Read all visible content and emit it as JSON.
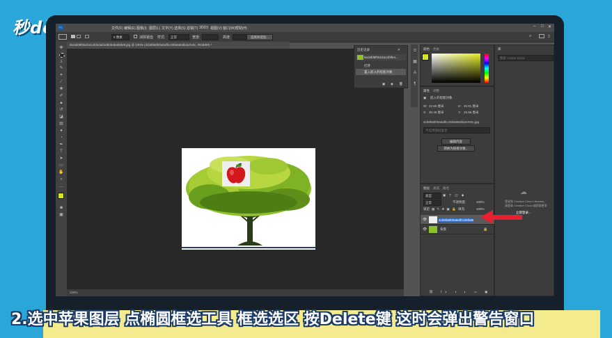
{
  "branding": {
    "logo_text": "秒dòng视频"
  },
  "menu": {
    "items": [
      "PS",
      "文件(F)",
      "编辑(E)",
      "图像(I)",
      "图层(L)",
      "文字(Y)",
      "选择(S)",
      "滤镜(T)",
      "3D(D)",
      "视图(V)",
      "窗口(W)",
      "帮助(H)"
    ]
  },
  "options": {
    "feather_value": "0 像素",
    "anti_alias_label": "消除锯齿",
    "style_label": "样式:",
    "style_value": "正常",
    "width_label": "宽度:",
    "height_label": "高度:",
    "select_mask_button": "选择并遮住..."
  },
  "document": {
    "tab_title": "8a16fd9f0522a14fde4a02d8284bab5fe8.jpg @ 100% (4cb8fa5f00a6affcc05fa550db3a7e0c, RGB/8#) *",
    "zoom_status": "100%"
  },
  "history": {
    "tabs": [
      "历史记录"
    ],
    "snapshot_label": "8a16fd9f0522a14f3fe4...",
    "items": [
      "打开",
      "置入嵌入的智能对象"
    ]
  },
  "color": {
    "tabs": [
      "颜色",
      "色板"
    ]
  },
  "properties": {
    "tabs": [
      "属性",
      "调整"
    ],
    "object_title": "嵌入的智能对象",
    "w_label": "W:",
    "w_value": "22.80 厘米",
    "h_label": "H:",
    "h_value": "20.91 厘米",
    "x_label": "X:",
    "x_value": "36.49 厘米",
    "y_label": "Y:",
    "y_value": "25.96 厘米",
    "filename": "4cb8fa5f00a6affcc05fa550db3a7e0c.jpg",
    "comp_placeholder": "不应用图层复合",
    "edit_button": "编辑内容",
    "convert_button": "转换为链接对象..."
  },
  "layers": {
    "tabs": [
      "图层",
      "通道",
      "路径"
    ],
    "kind_filter": "类型",
    "blend_mode": "正常",
    "opacity_label": "不透明度:",
    "opacity_value": "100%",
    "lock_label": "锁定:",
    "fill_label": "填充:",
    "fill_value": "100%",
    "items": [
      {
        "name": "4cb8fa5f00a6affcc05fa550",
        "kind": "smart"
      },
      {
        "name": "背景",
        "kind": "bg"
      }
    ]
  },
  "libraries": {
    "tabs": [
      "库"
    ],
    "search_placeholder": "搜索 Adobe Stock",
    "message_line1": "登录到 Creative Cloud Libraries,",
    "message_line2": "请登录 Creative Cloud 或获取更多",
    "login_link": "立即登录..."
  },
  "subtitle": {
    "text": "2.选中苹果图层 点椭圆框选工具 框选选区 按Delete键 这时会弹出警告窗口"
  },
  "colors": {
    "accent_arrow": "#e8202f",
    "foreground_swatch": "#d6e61e",
    "subtitle_band": "#f4eb8e",
    "background": "#2aa6d8"
  }
}
